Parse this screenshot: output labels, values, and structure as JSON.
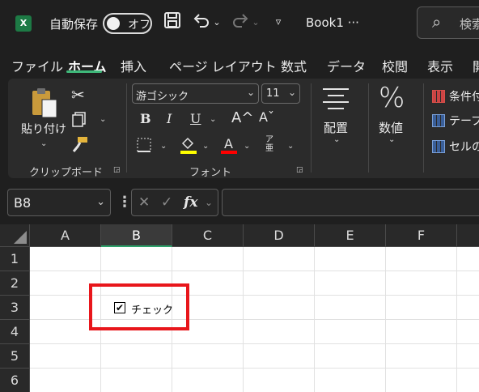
{
  "titlebar": {
    "app_icon": "excel-logo",
    "autosave_label": "自動保存",
    "autosave_state": "オフ",
    "save_icon": "save-icon",
    "undo_icon": "undo-icon",
    "redo_icon": "redo-icon",
    "customize_icon": "customize-qat-icon",
    "book_title": "Book1  ‧‧‧",
    "search_placeholder": "検索"
  },
  "tabs": [
    "ファイル",
    "ホーム",
    "挿入",
    "ページ レイアウト",
    "数式",
    "データ",
    "校閲",
    "表示",
    "開"
  ],
  "active_tab": "ホーム",
  "ribbon": {
    "clipboard": {
      "paste_label": "貼り付け",
      "group_label": "クリップボード"
    },
    "font": {
      "font_name": "游ゴシック",
      "font_size": "11",
      "bold": "B",
      "italic": "I",
      "underline": "U",
      "grow": "A^",
      "shrink": "Aˇ",
      "group_label": "フォント",
      "fill_color": "#ffff00",
      "font_color": "#ff0000"
    },
    "alignment": {
      "label": "配置"
    },
    "number": {
      "label": "数値",
      "symbol": "%"
    },
    "styles": {
      "items": [
        "条件付",
        "テーブ",
        "セルの"
      ]
    }
  },
  "formula_bar": {
    "name_box": "B8",
    "fx": "fx",
    "formula": ""
  },
  "grid": {
    "columns": [
      "A",
      "B",
      "C",
      "D",
      "E",
      "F"
    ],
    "selected_column": "B",
    "rows": [
      "1",
      "2",
      "3",
      "4",
      "5",
      "6"
    ]
  },
  "checkbox": {
    "label": "チェック",
    "checked": true
  },
  "colors": {
    "accent": "#2ea26b",
    "highlight": "#e8161b",
    "excel_green": "#1d7a45"
  }
}
